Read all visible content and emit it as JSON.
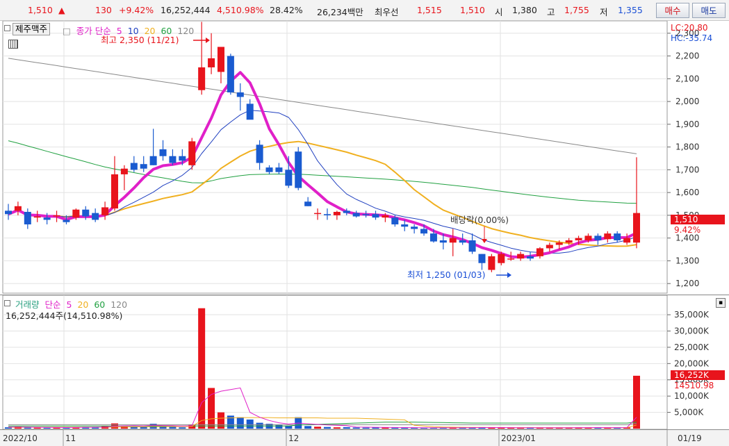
{
  "header": {
    "price": "1,510",
    "up_mark": "▲",
    "change": "130",
    "change_pct": "+9.42%",
    "volume": "16,252,444",
    "volume_ratio": "4,510.98%",
    "turnover_rate": "28.42%",
    "trade_value": "26,234백만",
    "best_ask_label": "최우선",
    "best_ask": "1,515",
    "best_bid": "1,510",
    "open_label": "시",
    "open": "1,380",
    "high_label": "고",
    "high": "1,755",
    "low_label": "저",
    "low": "1,355",
    "buy_button": "매수",
    "sell_button": "매도"
  },
  "price_panel": {
    "category_button": "제주맥주",
    "legend": {
      "label": "종가 단순",
      "periods": [
        "5",
        "10",
        "20",
        "60",
        "120"
      ]
    },
    "lc": "LC:20.80",
    "hc": "HC:-35.74",
    "high_annotation": "최고 2,350 (11/21)",
    "low_annotation": "최저 1,250 (01/03)",
    "dividend_annotation": "배당락(0.00%)",
    "current_price_tag": "1,510",
    "current_pct_tag": "9.42%",
    "y_ticks": [
      "2,300",
      "2,200",
      "2,100",
      "2,000",
      "1,900",
      "1,800",
      "1,700",
      "1,600",
      "1,500",
      "1,400",
      "1,300",
      "1,200"
    ]
  },
  "volume_panel": {
    "legend": {
      "label": "거래량",
      "ma_label": "단순",
      "periods": [
        "5",
        "20",
        "60",
        "120"
      ]
    },
    "current_volume": "16,252,444주(14,510.98%)",
    "current_tag": "16,252K",
    "current_pct_tag": "14510.98",
    "y_ticks": [
      "35,000K",
      "30,000K",
      "25,000K",
      "20,000K",
      "15,000K",
      "10,000K",
      "5,000K"
    ]
  },
  "x_axis": {
    "labels": [
      "2022/10",
      "11",
      "12",
      "2023/01",
      "01/19"
    ]
  },
  "colors": {
    "up": "#e8141c",
    "down": "#1a5bd0",
    "ma5": "#e020c8",
    "ma10": "#2040c0",
    "ma20": "#f0b020",
    "ma60": "#20a040",
    "ma120": "#888888"
  },
  "chart_data": {
    "type": "candlestick",
    "title": "",
    "price_ylim": [
      1170,
      2330
    ],
    "volume_ylim": [
      0,
      38000
    ],
    "volume_unit": "K",
    "candles": [
      {
        "o": 1520,
        "h": 1550,
        "l": 1480,
        "c": 1505
      },
      {
        "o": 1520,
        "h": 1560,
        "l": 1500,
        "c": 1540
      },
      {
        "o": 1515,
        "h": 1530,
        "l": 1440,
        "c": 1460
      },
      {
        "o": 1490,
        "h": 1520,
        "l": 1470,
        "c": 1495
      },
      {
        "o": 1490,
        "h": 1510,
        "l": 1460,
        "c": 1480
      },
      {
        "o": 1495,
        "h": 1520,
        "l": 1470,
        "c": 1500
      },
      {
        "o": 1480,
        "h": 1500,
        "l": 1460,
        "c": 1470
      },
      {
        "o": 1490,
        "h": 1530,
        "l": 1480,
        "c": 1525
      },
      {
        "o": 1525,
        "h": 1540,
        "l": 1480,
        "c": 1495
      },
      {
        "o": 1510,
        "h": 1530,
        "l": 1470,
        "c": 1480
      },
      {
        "o": 1500,
        "h": 1560,
        "l": 1480,
        "c": 1535
      },
      {
        "o": 1530,
        "h": 1760,
        "l": 1520,
        "c": 1680
      },
      {
        "o": 1680,
        "h": 1720,
        "l": 1610,
        "c": 1705
      },
      {
        "o": 1730,
        "h": 1760,
        "l": 1690,
        "c": 1700
      },
      {
        "o": 1725,
        "h": 1760,
        "l": 1690,
        "c": 1705
      },
      {
        "o": 1760,
        "h": 1880,
        "l": 1720,
        "c": 1720
      },
      {
        "o": 1790,
        "h": 1830,
        "l": 1740,
        "c": 1760
      },
      {
        "o": 1760,
        "h": 1790,
        "l": 1720,
        "c": 1730
      },
      {
        "o": 1760,
        "h": 1790,
        "l": 1720,
        "c": 1740
      },
      {
        "o": 1720,
        "h": 1840,
        "l": 1700,
        "c": 1825
      },
      {
        "o": 2050,
        "h": 2350,
        "l": 2030,
        "c": 2150
      },
      {
        "o": 2150,
        "h": 2300,
        "l": 2120,
        "c": 2190
      },
      {
        "o": 2130,
        "h": 2230,
        "l": 2080,
        "c": 2240
      },
      {
        "o": 2200,
        "h": 2210,
        "l": 2030,
        "c": 2040
      },
      {
        "o": 2040,
        "h": 2080,
        "l": 1960,
        "c": 2020
      },
      {
        "o": 1990,
        "h": 2010,
        "l": 1930,
        "c": 1920
      },
      {
        "o": 1810,
        "h": 1830,
        "l": 1700,
        "c": 1730
      },
      {
        "o": 1710,
        "h": 1720,
        "l": 1680,
        "c": 1690
      },
      {
        "o": 1710,
        "h": 1730,
        "l": 1680,
        "c": 1690
      },
      {
        "o": 1700,
        "h": 1760,
        "l": 1620,
        "c": 1630
      },
      {
        "o": 1780,
        "h": 1800,
        "l": 1610,
        "c": 1620
      },
      {
        "o": 1560,
        "h": 1580,
        "l": 1540,
        "c": 1540
      },
      {
        "o": 1510,
        "h": 1530,
        "l": 1480,
        "c": 1510
      },
      {
        "o": 1505,
        "h": 1530,
        "l": 1480,
        "c": 1500
      },
      {
        "o": 1500,
        "h": 1520,
        "l": 1480,
        "c": 1515
      },
      {
        "o": 1520,
        "h": 1530,
        "l": 1500,
        "c": 1510
      },
      {
        "o": 1510,
        "h": 1520,
        "l": 1490,
        "c": 1495
      },
      {
        "o": 1505,
        "h": 1520,
        "l": 1490,
        "c": 1500
      },
      {
        "o": 1505,
        "h": 1520,
        "l": 1480,
        "c": 1490
      },
      {
        "o": 1490,
        "h": 1510,
        "l": 1470,
        "c": 1500
      },
      {
        "o": 1490,
        "h": 1500,
        "l": 1450,
        "c": 1460
      },
      {
        "o": 1460,
        "h": 1480,
        "l": 1430,
        "c": 1450
      },
      {
        "o": 1450,
        "h": 1460,
        "l": 1420,
        "c": 1440
      },
      {
        "o": 1440,
        "h": 1460,
        "l": 1410,
        "c": 1420
      },
      {
        "o": 1420,
        "h": 1440,
        "l": 1380,
        "c": 1385
      },
      {
        "o": 1390,
        "h": 1420,
        "l": 1350,
        "c": 1380
      },
      {
        "o": 1380,
        "h": 1440,
        "l": 1320,
        "c": 1400
      },
      {
        "o": 1390,
        "h": 1420,
        "l": 1370,
        "c": 1380
      },
      {
        "o": 1390,
        "h": 1420,
        "l": 1330,
        "c": 1340
      },
      {
        "o": 1330,
        "h": 1330,
        "l": 1260,
        "c": 1290
      },
      {
        "o": 1260,
        "h": 1330,
        "l": 1250,
        "c": 1320
      },
      {
        "o": 1290,
        "h": 1340,
        "l": 1280,
        "c": 1330
      },
      {
        "o": 1310,
        "h": 1340,
        "l": 1300,
        "c": 1310
      },
      {
        "o": 1310,
        "h": 1340,
        "l": 1300,
        "c": 1330
      },
      {
        "o": 1320,
        "h": 1340,
        "l": 1300,
        "c": 1310
      },
      {
        "o": 1320,
        "h": 1360,
        "l": 1310,
        "c": 1355
      },
      {
        "o": 1355,
        "h": 1380,
        "l": 1340,
        "c": 1370
      },
      {
        "o": 1370,
        "h": 1390,
        "l": 1350,
        "c": 1380
      },
      {
        "o": 1380,
        "h": 1400,
        "l": 1370,
        "c": 1390
      },
      {
        "o": 1390,
        "h": 1410,
        "l": 1370,
        "c": 1400
      },
      {
        "o": 1390,
        "h": 1420,
        "l": 1380,
        "c": 1410
      },
      {
        "o": 1410,
        "h": 1420,
        "l": 1370,
        "c": 1390
      },
      {
        "o": 1395,
        "h": 1430,
        "l": 1380,
        "c": 1420
      },
      {
        "o": 1420,
        "h": 1430,
        "l": 1380,
        "c": 1390
      },
      {
        "o": 1380,
        "h": 1420,
        "l": 1370,
        "c": 1400
      },
      {
        "o": 1380,
        "h": 1755,
        "l": 1355,
        "c": 1510
      }
    ],
    "volumes": [
      400,
      600,
      350,
      300,
      280,
      350,
      300,
      400,
      500,
      450,
      800,
      1600,
      700,
      600,
      500,
      1500,
      600,
      500,
      400,
      1200,
      37000,
      12500,
      5000,
      4000,
      3500,
      2800,
      1800,
      1500,
      1200,
      900,
      3500,
      800,
      600,
      500,
      400,
      450,
      350,
      300,
      400,
      350,
      300,
      250,
      220,
      200,
      300,
      250,
      350,
      280,
      300,
      400,
      350,
      250,
      220,
      200,
      250,
      300,
      280,
      250,
      300,
      350,
      280,
      320,
      300,
      250,
      350,
      16252
    ],
    "ma5_volume": [
      500,
      500,
      450,
      400,
      380,
      350,
      330,
      350,
      400,
      420,
      500,
      750,
      850,
      900,
      850,
      1000,
      950,
      900,
      800,
      900,
      8000,
      10500,
      11500,
      12000,
      12500,
      5000,
      3500,
      2500,
      1800,
      1400,
      1700,
      1500,
      1300,
      1100,
      1000,
      900,
      500,
      450,
      400,
      380,
      350,
      330,
      300,
      280,
      260,
      250,
      270,
      280,
      300,
      320,
      330,
      320,
      300,
      260,
      250,
      250,
      260,
      270,
      280,
      300,
      300,
      310,
      300,
      300,
      310,
      3500
    ],
    "ma20_volume": [
      400,
      400,
      400,
      400,
      400,
      400,
      400,
      400,
      400,
      400,
      450,
      500,
      520,
      540,
      560,
      600,
      620,
      640,
      650,
      700,
      2500,
      3000,
      3200,
      3300,
      3400,
      3400,
      3400,
      3400,
      3300,
      3300,
      3300,
      3300,
      3300,
      3200,
      3200,
      3200,
      3200,
      3100,
      3000,
      2900,
      2800,
      2700,
      1000,
      800,
      600,
      500,
      450,
      400,
      380,
      360,
      350,
      340,
      330,
      320,
      310,
      300,
      300,
      300,
      300,
      300,
      300,
      300,
      300,
      300,
      300,
      1100
    ],
    "ma60_volume": [
      800,
      800,
      800,
      800,
      800,
      800,
      800,
      800,
      800,
      800,
      800,
      800,
      800,
      800,
      800,
      800,
      800,
      800,
      800,
      800,
      800,
      800,
      800,
      800,
      800,
      800,
      800,
      800,
      800,
      800,
      1100,
      1200,
      1300,
      1400,
      1500,
      1600,
      1700,
      1800,
      1900,
      2000,
      2000,
      2000,
      2000,
      1950,
      1900,
      1850,
      1800,
      1750,
      1700,
      1700,
      1700,
      1700,
      1700,
      1700,
      1700,
      1700,
      1700,
      1700,
      1700,
      1700,
      1700,
      1700,
      1700,
      1700,
      1700,
      2000
    ],
    "ma120_volume": [
      1200,
      1200,
      1200,
      1200,
      1200,
      1200,
      1200,
      1200,
      1200,
      1200,
      1200,
      1200,
      1200,
      1200,
      1200,
      1200,
      1200,
      1200,
      1200,
      1200,
      1200,
      1200,
      1200,
      1200,
      1200,
      1200,
      1200,
      1200,
      1200,
      1200,
      1200,
      1200,
      1200,
      1200,
      1200,
      1200,
      1200,
      1200,
      1200,
      1200,
      1200,
      1200,
      1200,
      1200,
      1200,
      1200,
      1200,
      1200,
      1200,
      1200,
      1200,
      1200,
      1200,
      1200,
      1200,
      1200,
      1200,
      1200,
      1200,
      1200,
      1200,
      1200,
      1200,
      1200,
      1200,
      1600
    ]
  }
}
